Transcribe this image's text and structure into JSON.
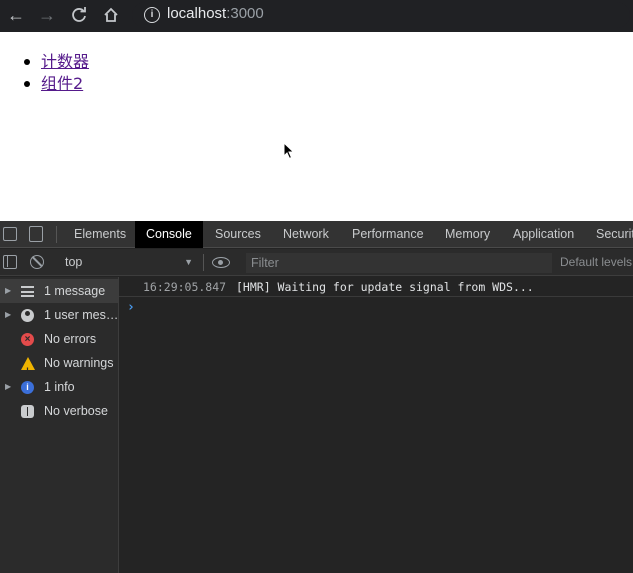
{
  "browser": {
    "url_host": "localhost",
    "url_port": ":3000",
    "info_glyph": "i"
  },
  "page": {
    "links": [
      "计数器",
      "组件2"
    ]
  },
  "devtools": {
    "tabs": [
      "Elements",
      "Console",
      "Sources",
      "Network",
      "Performance",
      "Memory",
      "Application",
      "Securit"
    ],
    "active_tab": "Console",
    "context": "top",
    "filter_placeholder": "Filter",
    "levels_label": "Default levels",
    "sidebar": [
      {
        "label": "1 message",
        "icon": "list-icon",
        "expandable": true
      },
      {
        "label": "1 user mes…",
        "icon": "user-icon",
        "expandable": true
      },
      {
        "label": "No errors",
        "icon": "error-icon",
        "expandable": false
      },
      {
        "label": "No warnings",
        "icon": "warning-icon",
        "expandable": false
      },
      {
        "label": "1 info",
        "icon": "info-icon",
        "expandable": true
      },
      {
        "label": "No verbose",
        "icon": "bug-icon",
        "expandable": false
      }
    ],
    "log": {
      "time": "16:29:05.847",
      "message": "[HMR] Waiting for update signal from WDS..."
    },
    "prompt": "›"
  }
}
